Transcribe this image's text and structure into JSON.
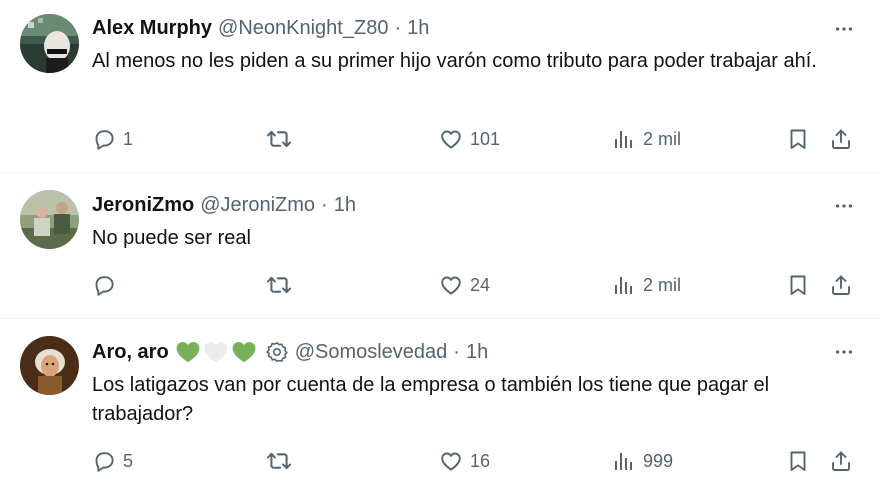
{
  "tweets": [
    {
      "name": "Alex Murphy",
      "handle": "@NeonKnight_Z80",
      "separator": "·",
      "time": "1h",
      "text": "Al menos no les piden a su primer hijo varón como tributo para poder trabajar ahí.",
      "replies": "1",
      "retweets": "",
      "likes": "101",
      "views": "2 mil"
    },
    {
      "name": "JeroniZmo",
      "handle": "@JeroniZmo",
      "separator": "·",
      "time": "1h",
      "text": "No puede ser real",
      "replies": "",
      "retweets": "",
      "likes": "24",
      "views": "2 mil"
    },
    {
      "name": "Aro, aro",
      "handle": "@Somoslevedad",
      "separator": "·",
      "time": "1h",
      "text": "Los latigazos van por cuenta de la empresa o también los tiene que pagar el trabajador?",
      "replies": "5",
      "retweets": "",
      "likes": "16",
      "views": "999",
      "name_emojis": [
        "green-heart",
        "white-heart",
        "green-heart"
      ],
      "badge_icon": "gear-badge-icon"
    }
  ],
  "colors": {
    "text_primary": "#0f1419",
    "text_secondary": "#536471",
    "divider": "#eff3f4",
    "green_heart": "#78b159"
  },
  "icons": [
    "reply-icon",
    "retweet-icon",
    "like-icon",
    "views-icon",
    "bookmark-icon",
    "share-icon",
    "more-icon"
  ]
}
